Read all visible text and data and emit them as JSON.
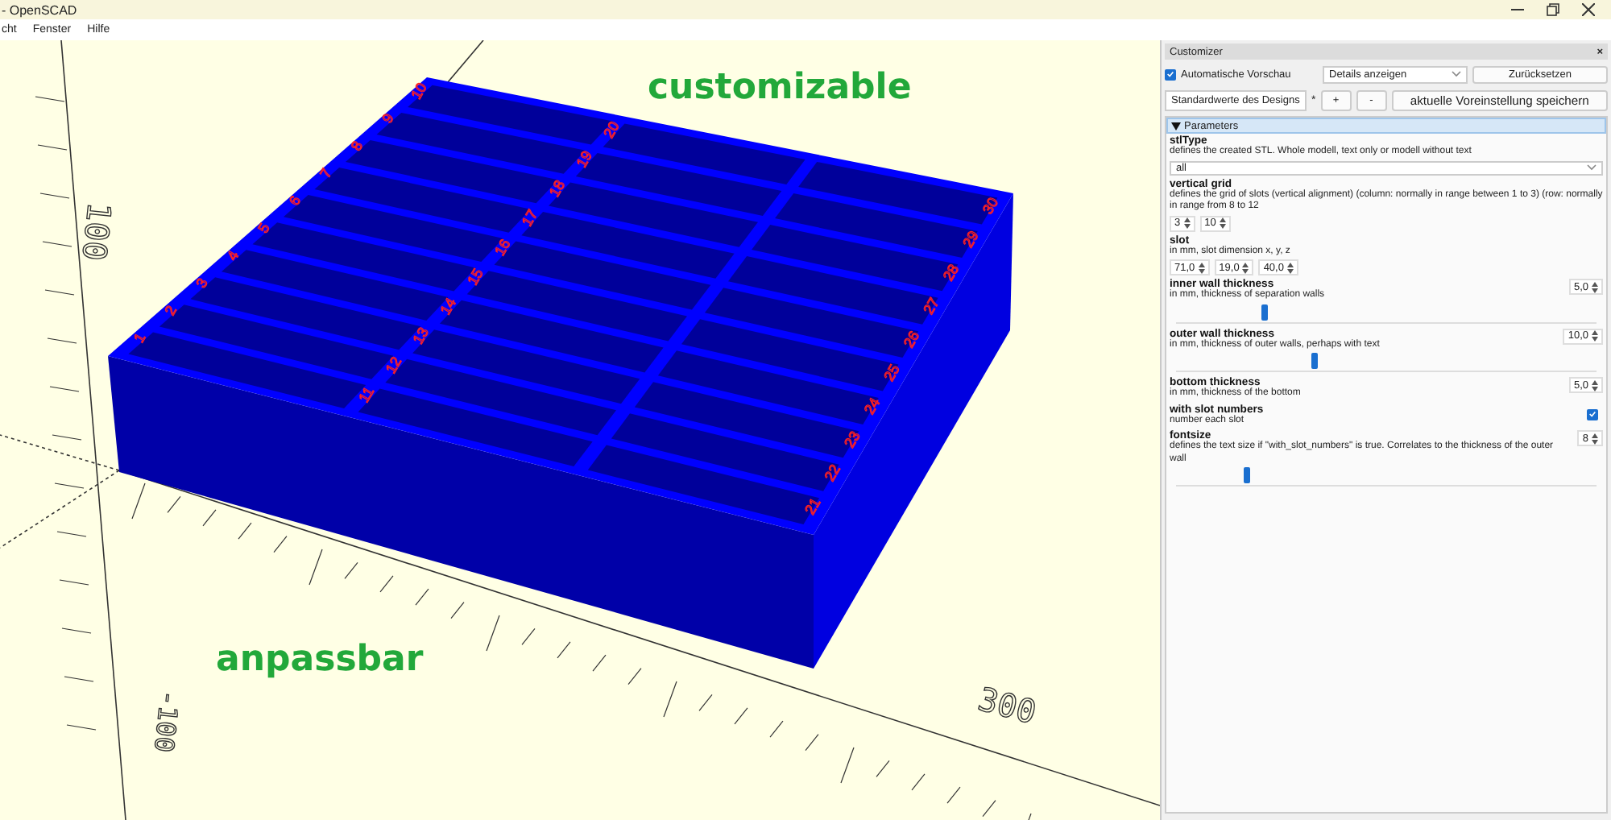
{
  "window": {
    "title": "- OpenSCAD"
  },
  "menu": [
    "cht",
    "Fenster",
    "Hilfe"
  ],
  "viewport": {
    "caption_top": "customizable",
    "caption_bottom": "anpassbar",
    "axis_labels": [
      "100",
      "300",
      "-100"
    ],
    "slot_numbers": [
      "1",
      "2",
      "3",
      "4",
      "5",
      "6",
      "7",
      "8",
      "9",
      "10",
      "11",
      "12",
      "13",
      "14",
      "15",
      "16",
      "17",
      "18",
      "19",
      "20",
      "21",
      "22",
      "23",
      "24",
      "25",
      "26",
      "27",
      "28",
      "29",
      "30"
    ]
  },
  "customizer": {
    "title": "Customizer",
    "close": "×",
    "auto_preview": {
      "label": "Automatische Vorschau",
      "checked": true
    },
    "details_select": "Details anzeigen",
    "reset_button": "Zurücksetzen",
    "preset_select": "Standardwerte des Designs",
    "modified_mark": "*",
    "add_button": "+",
    "remove_button": "-",
    "save_button": "aktuelle Voreinstellung speichern",
    "group": {
      "title": "Parameters",
      "expanded": true
    },
    "parameters": [
      {
        "kind": "select",
        "name": "stlType",
        "description": "defines the created STL. Whole modell, text only or modell without text",
        "value": "all"
      },
      {
        "kind": "spinners",
        "name": "vertical grid",
        "description": "defines the grid of slots (vertical alignment) (column: normally in range between 1 to 3) (row: normally in range from 8 to 12",
        "values": [
          "3",
          "10"
        ]
      },
      {
        "kind": "spinners",
        "name": "slot",
        "description": "in mm, slot dimension x, y, z",
        "values": [
          "71,0",
          "19,0",
          "40,0"
        ]
      },
      {
        "kind": "slider",
        "name": "inner wall thickness",
        "description": "in mm, thickness of separation walls",
        "value": "5,0",
        "level": 0.21
      },
      {
        "kind": "slider",
        "name": "outer wall thickness",
        "description": "in mm, thickness of outer walls, perhaps with text",
        "value": "10,0",
        "level": 0.33
      },
      {
        "kind": "number",
        "name": "bottom thickness",
        "description": "in mm, thickness of the bottom",
        "value": "5,0"
      },
      {
        "kind": "checkbox",
        "name": "with slot numbers",
        "description": "number each slot",
        "checked": true
      },
      {
        "kind": "slider",
        "name": "fontsize",
        "description": "defines the text size if \"with_slot_numbers\" is true. Correlates to the thickness of the outer wall",
        "value": "8",
        "level": 0.17
      }
    ]
  }
}
